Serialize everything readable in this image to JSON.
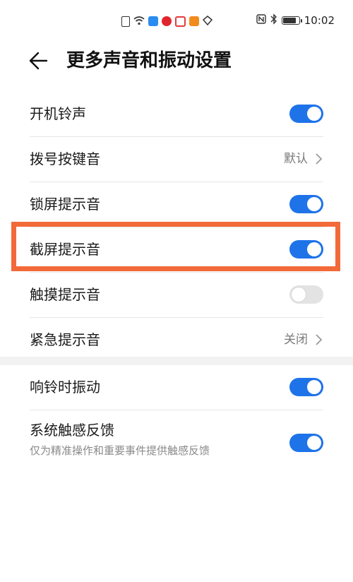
{
  "status_bar": {
    "time": "10:02",
    "left_icons": [
      "sim-alert-icon",
      "wifi-icon",
      "cloud-icon",
      "huawei-icon",
      "app-icon",
      "video-icon",
      "diamond-icon"
    ],
    "right_icons": [
      "nfc-icon",
      "bluetooth-icon",
      "battery-icon"
    ],
    "battery_level": 0.85
  },
  "header": {
    "title": "更多声音和振动设置"
  },
  "settings": [
    {
      "label": "开机铃声",
      "type": "toggle",
      "on": true
    },
    {
      "label": "拨号按键音",
      "type": "select",
      "value": "默认"
    },
    {
      "label": "锁屏提示音",
      "type": "toggle",
      "on": true
    },
    {
      "label": "截屏提示音",
      "type": "toggle",
      "on": true,
      "highlighted": true
    },
    {
      "label": "触摸提示音",
      "type": "toggle",
      "on": false
    },
    {
      "label": "紧急提示音",
      "type": "select",
      "value": "关闭"
    }
  ],
  "vibration_settings": [
    {
      "label": "响铃时振动",
      "type": "toggle",
      "on": true
    },
    {
      "label": "系统触感反馈",
      "sublabel": "仅为精准操作和重要事件提供触感反馈",
      "type": "toggle",
      "on": true
    }
  ],
  "colors": {
    "toggle_on": "#1e73e8",
    "toggle_off": "#e3e3e3",
    "highlight_border": "#f26a3a"
  }
}
